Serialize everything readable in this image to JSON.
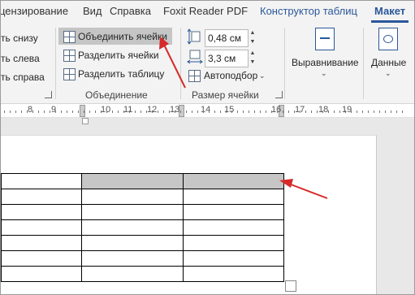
{
  "tabs": [
    {
      "label": "цензирование"
    },
    {
      "label": "Вид"
    },
    {
      "label": "Справка"
    },
    {
      "label": "Foxit Reader PDF"
    },
    {
      "label": "Конструктор таблиц"
    },
    {
      "label": "Макет"
    }
  ],
  "rows_cols": {
    "below": "ть снизу",
    "left": "ть слева",
    "right": "ть справа"
  },
  "merge_group": {
    "merge_cells": "Объединить ячейки",
    "split_cells": "Разделить ячейки",
    "split_table": "Разделить таблицу",
    "label": "Объединение"
  },
  "cell_size": {
    "height": "0,48 см",
    "width": "3,3 см",
    "autofit": "Автоподбор",
    "label": "Размер ячейки"
  },
  "alignment": {
    "label": "Выравнивание"
  },
  "data_group": {
    "label": "Данные"
  },
  "ruler": {
    "numbers": [
      "8",
      "9",
      "10",
      "11",
      "12",
      "13",
      "14",
      "15",
      "16",
      "17",
      "18",
      "19"
    ]
  },
  "table": {
    "rows": 7,
    "cols": 3,
    "selected_cells": "first row, columns 2-3"
  },
  "colors": {
    "accent": "#2b579a",
    "selection": "#c6c6c6",
    "highlight": "#c5c5c5",
    "arrow": "#d62a2a"
  }
}
